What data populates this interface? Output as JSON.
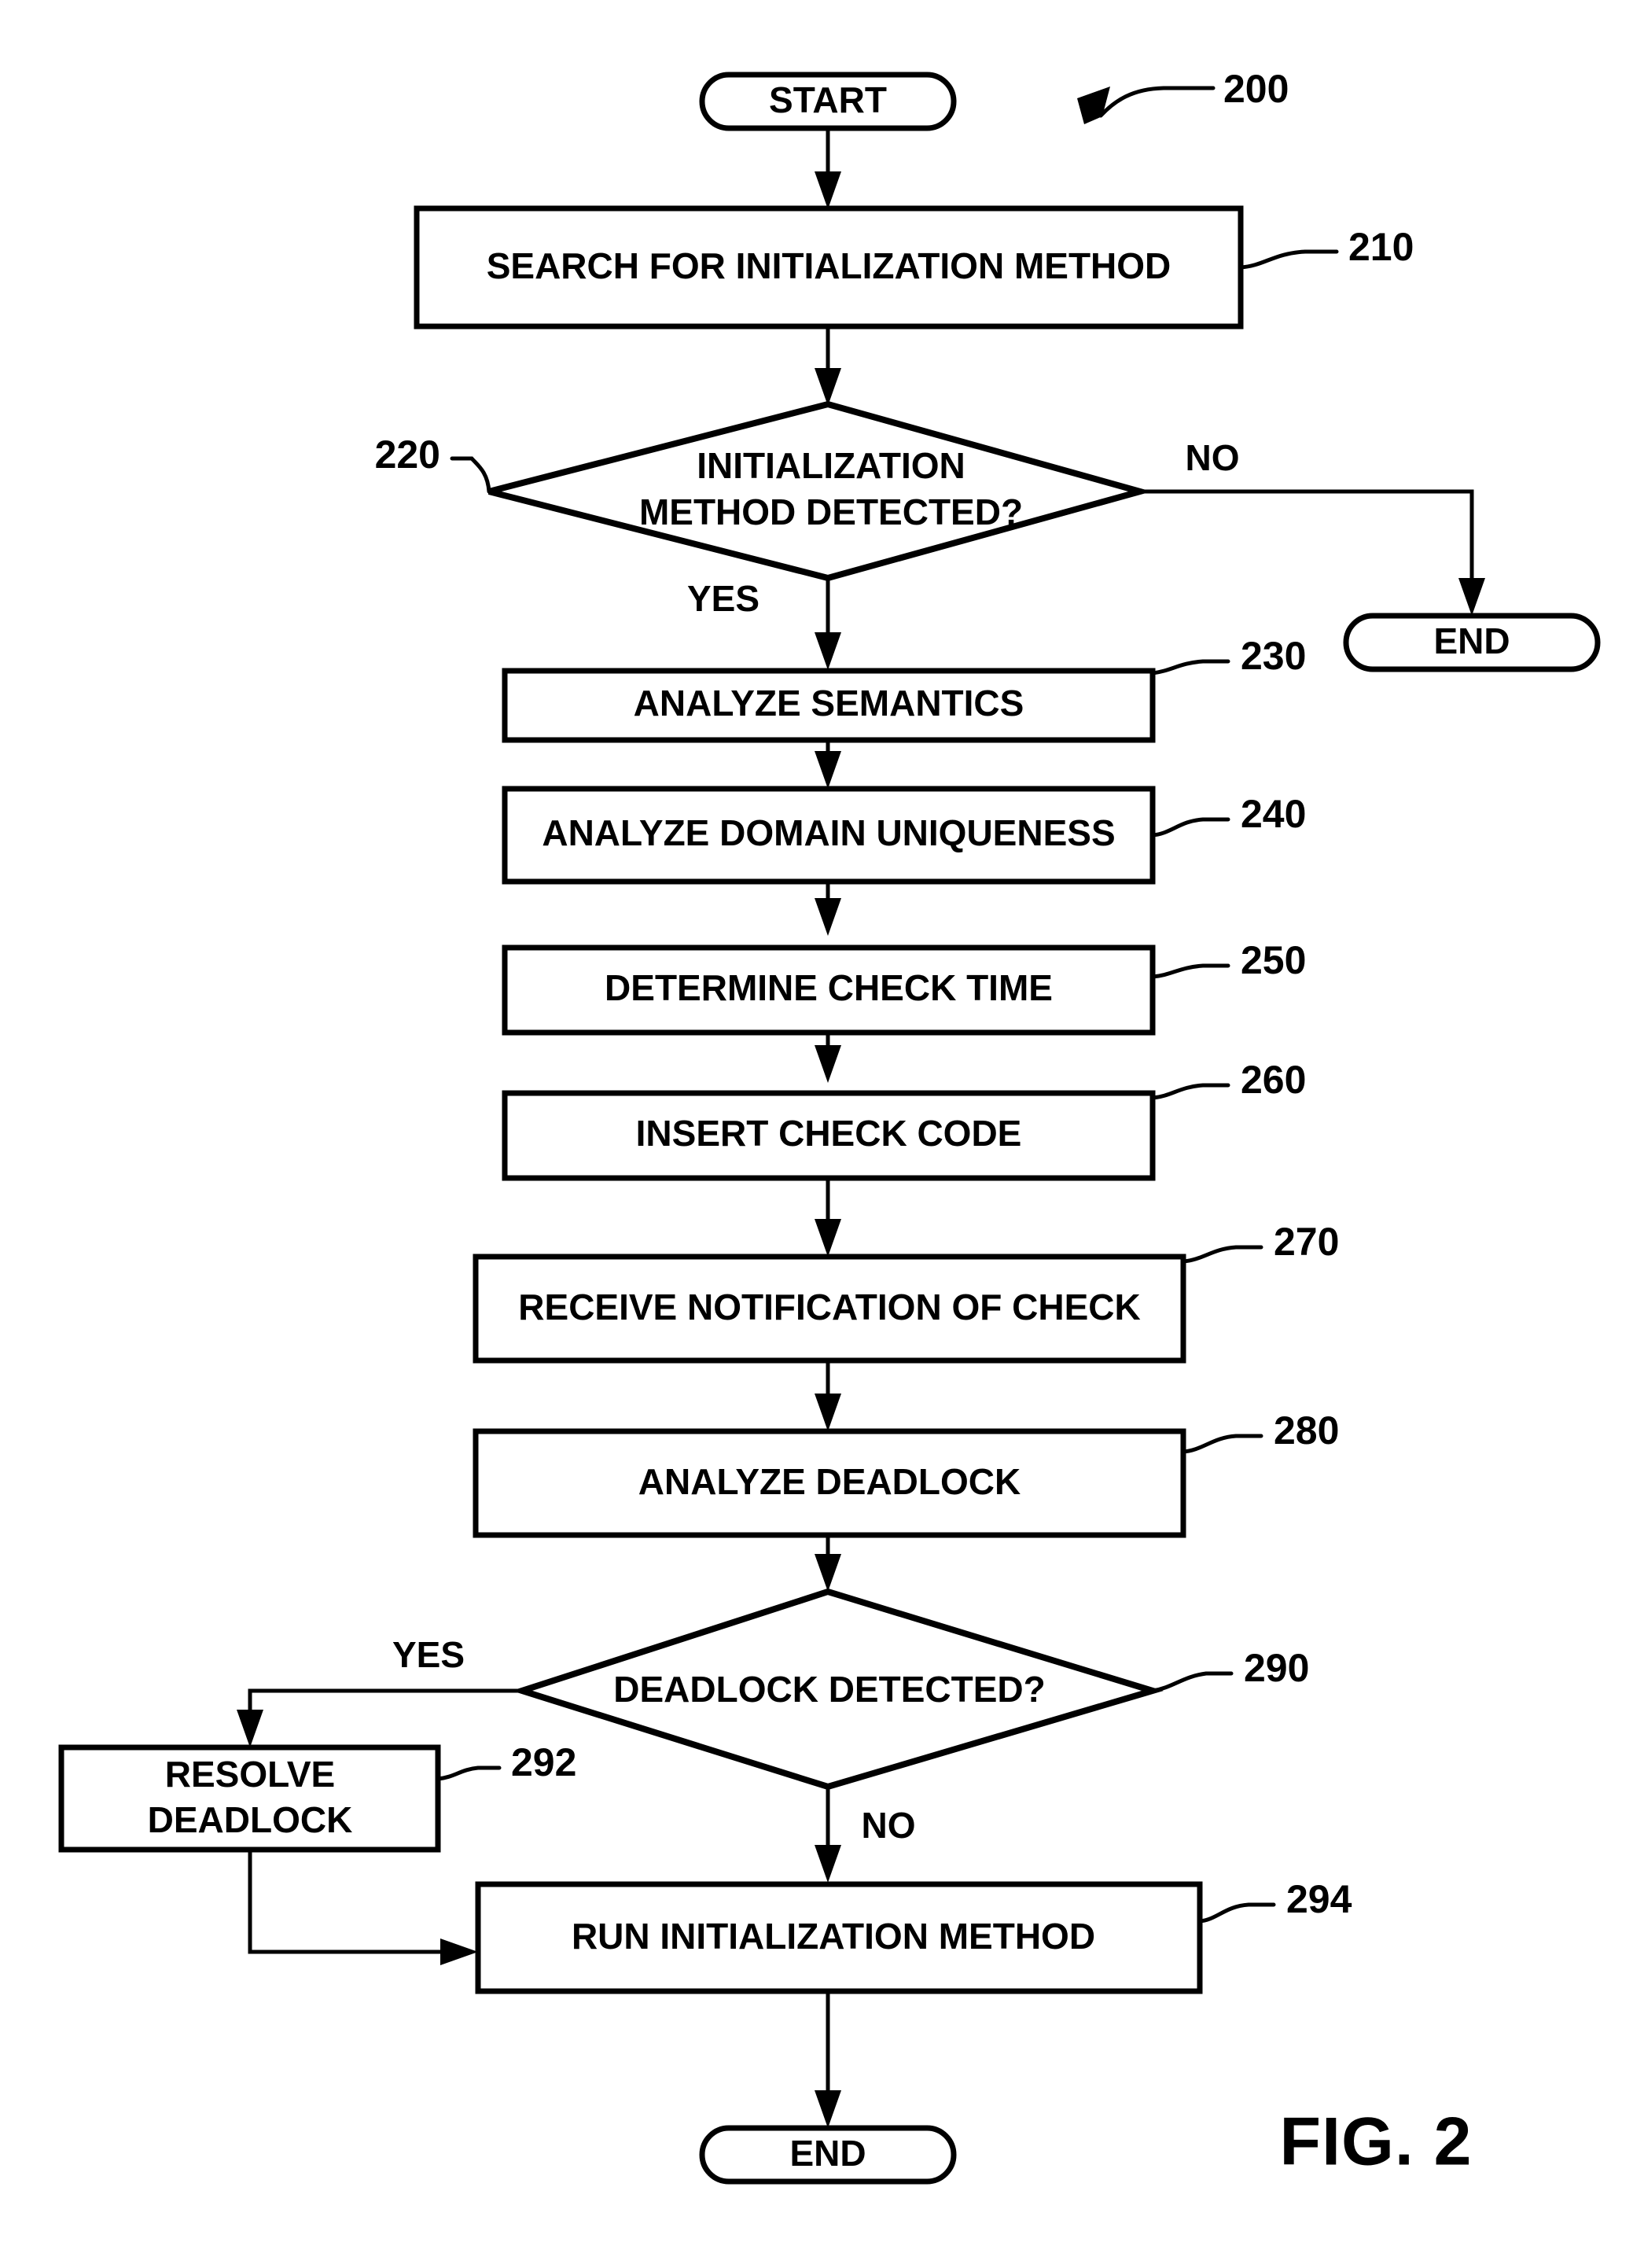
{
  "figure": {
    "caption": "FIG. 2",
    "diagram_ref": "200"
  },
  "nodes": {
    "start": {
      "label": "START",
      "ref": ""
    },
    "search": {
      "label": "SEARCH FOR INITIALIZATION METHOD",
      "ref": "210"
    },
    "decision_init": {
      "label_line1": "INITIALIZATION",
      "label_line2": "METHOD DETECTED?",
      "ref": "220"
    },
    "end_no": {
      "label": "END",
      "ref": ""
    },
    "semantics": {
      "label": "ANALYZE SEMANTICS",
      "ref": "230"
    },
    "domain": {
      "label": "ANALYZE DOMAIN UNIQUENESS",
      "ref": "240"
    },
    "check_time": {
      "label": "DETERMINE CHECK TIME",
      "ref": "250"
    },
    "insert_code": {
      "label": "INSERT CHECK CODE",
      "ref": "260"
    },
    "notification": {
      "label": "RECEIVE NOTIFICATION OF CHECK",
      "ref": "270"
    },
    "analyze_deadlock": {
      "label": "ANALYZE DEADLOCK",
      "ref": "280"
    },
    "decision_deadlock": {
      "label": "DEADLOCK DETECTED?",
      "ref": "290"
    },
    "resolve": {
      "label_line1": "RESOLVE",
      "label_line2": "DEADLOCK",
      "ref": "292"
    },
    "run_init": {
      "label": "RUN INITIALIZATION METHOD",
      "ref": "294"
    },
    "end_final": {
      "label": "END",
      "ref": ""
    }
  },
  "branches": {
    "init_yes": "YES",
    "init_no": "NO",
    "deadlock_yes": "YES",
    "deadlock_no": "NO"
  },
  "style": {
    "stroke_color": "#000000",
    "fill_color": "#ffffff",
    "background": "#ffffff"
  }
}
